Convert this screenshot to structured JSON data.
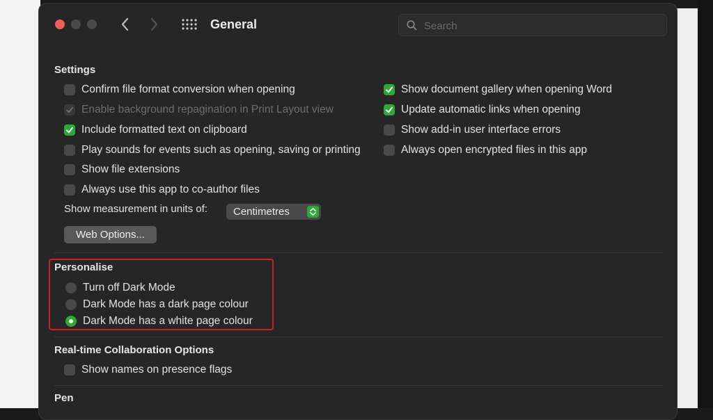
{
  "window": {
    "title": "General"
  },
  "search": {
    "placeholder": "Search"
  },
  "settings": {
    "title": "Settings",
    "left": [
      {
        "label": "Confirm file format conversion when opening",
        "checked": false,
        "disabled": false
      },
      {
        "label": "Enable background repagination in Print Layout view",
        "checked": true,
        "disabled": true
      },
      {
        "label": "Include formatted text on clipboard",
        "checked": true,
        "disabled": false
      },
      {
        "label": "Play sounds for events such as opening, saving or printing",
        "checked": false,
        "disabled": false
      },
      {
        "label": "Show file extensions",
        "checked": false,
        "disabled": false
      },
      {
        "label": "Always use this app to co-author files",
        "checked": false,
        "disabled": false
      }
    ],
    "right": [
      {
        "label": "Show document gallery when opening Word",
        "checked": true,
        "disabled": false
      },
      {
        "label": "Update automatic links when opening",
        "checked": true,
        "disabled": false
      },
      {
        "label": "Show add-in user interface errors",
        "checked": false,
        "disabled": false
      },
      {
        "label": "Always open encrypted files in this app",
        "checked": false,
        "disabled": false
      }
    ],
    "units_label": "Show measurement in units of:",
    "units_value": "Centimetres",
    "web_options_label": "Web Options..."
  },
  "personalise": {
    "title": "Personalise",
    "options": [
      {
        "label": "Turn off Dark Mode",
        "selected": false
      },
      {
        "label": "Dark Mode has a dark page colour",
        "selected": false
      },
      {
        "label": "Dark Mode has a white page colour",
        "selected": true
      }
    ]
  },
  "collaboration": {
    "title": "Real-time Collaboration Options",
    "option": {
      "label": "Show names on presence flags",
      "checked": false
    }
  },
  "pen": {
    "title": "Pen"
  },
  "colors": {
    "accent_green": "#2ea839",
    "highlight_red": "#d21f24",
    "window_bg": "#272627",
    "close_red": "#ed5f56"
  },
  "icons": {
    "back": "chevron-left-icon",
    "forward": "chevron-right-icon",
    "grid": "grid-icon",
    "search": "search-icon",
    "checkmark": "checkmark-icon",
    "stepper": "stepper-icon"
  }
}
